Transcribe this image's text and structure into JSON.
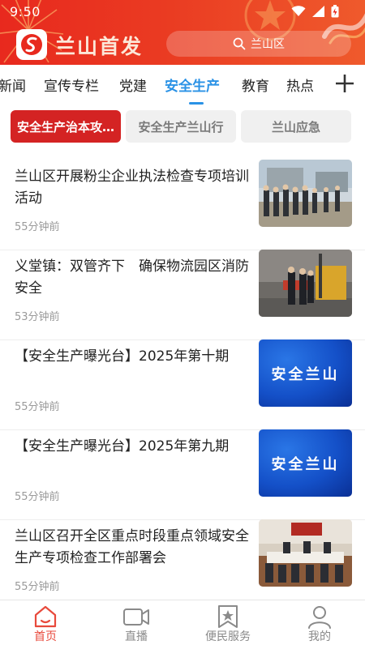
{
  "status_bar": {
    "time": "9:50"
  },
  "header": {
    "app_title": "兰山首发",
    "search_placeholder": "兰山区"
  },
  "tabs": [
    {
      "label": "新闻"
    },
    {
      "label": "宣传专栏"
    },
    {
      "label": "党建"
    },
    {
      "label": "安全生产",
      "active": true
    },
    {
      "label": "教育"
    },
    {
      "label": "热点"
    }
  ],
  "subtabs": [
    {
      "label": "安全生产治本攻…",
      "active": true
    },
    {
      "label": "安全生产兰山行"
    },
    {
      "label": "兰山应急"
    }
  ],
  "news": [
    {
      "title": "兰山区开展粉尘企业执法检查专项培训活动",
      "time": "55分钟前"
    },
    {
      "title": "义堂镇：双管齐下　确保物流园区消防安全",
      "time": "53分钟前"
    },
    {
      "title": "【安全生产曝光台】2025年第十期",
      "time": "55分钟前",
      "thumb_text": "安全兰山"
    },
    {
      "title": "【安全生产曝光台】2025年第九期",
      "time": "55分钟前",
      "thumb_text": "安全兰山"
    },
    {
      "title": "兰山区召开全区重点时段重点领域安全生产专项检查工作部署会",
      "time": "55分钟前"
    }
  ],
  "bottom_nav": [
    {
      "label": "首页",
      "icon": "home-icon",
      "active": true
    },
    {
      "label": "直播",
      "icon": "video-camera-icon"
    },
    {
      "label": "便民服务",
      "icon": "service-bookmark-icon"
    },
    {
      "label": "我的",
      "icon": "user-icon"
    }
  ],
  "colors": {
    "header_red": "#e8291e",
    "active_tab_blue": "#2a92e6",
    "active_subtab_red": "#d42323",
    "nav_active": "#e84a3c"
  }
}
